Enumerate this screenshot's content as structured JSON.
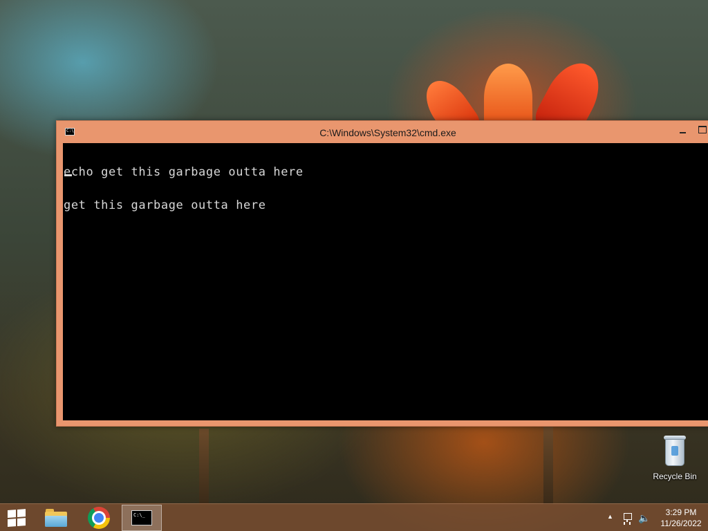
{
  "window": {
    "title": "C:\\Windows\\System32\\cmd.exe",
    "icon_name": "cmd-icon",
    "icon_text": "C:\\",
    "minimize_icon": "minimize-icon",
    "maximize_icon": "maximize-icon"
  },
  "console": {
    "lines": [
      "echo get this garbage outta here",
      "get this garbage outta here"
    ],
    "background": "#000000",
    "foreground": "#d8d8d8"
  },
  "desktop": {
    "recycle_bin_label": "Recycle Bin"
  },
  "taskbar": {
    "accent": "#e9966e",
    "apps": [
      {
        "name": "File Explorer",
        "icon": "folder-icon"
      },
      {
        "name": "Google Chrome",
        "icon": "chrome-icon"
      },
      {
        "name": "Command Prompt",
        "icon": "cmd-icon",
        "active": true
      }
    ],
    "cmd_icon_text": "C:\\_",
    "tray": {
      "chevron": "▲",
      "volume_glyph": "🔈",
      "time": "3:29 PM",
      "date": "11/26/2022"
    }
  }
}
